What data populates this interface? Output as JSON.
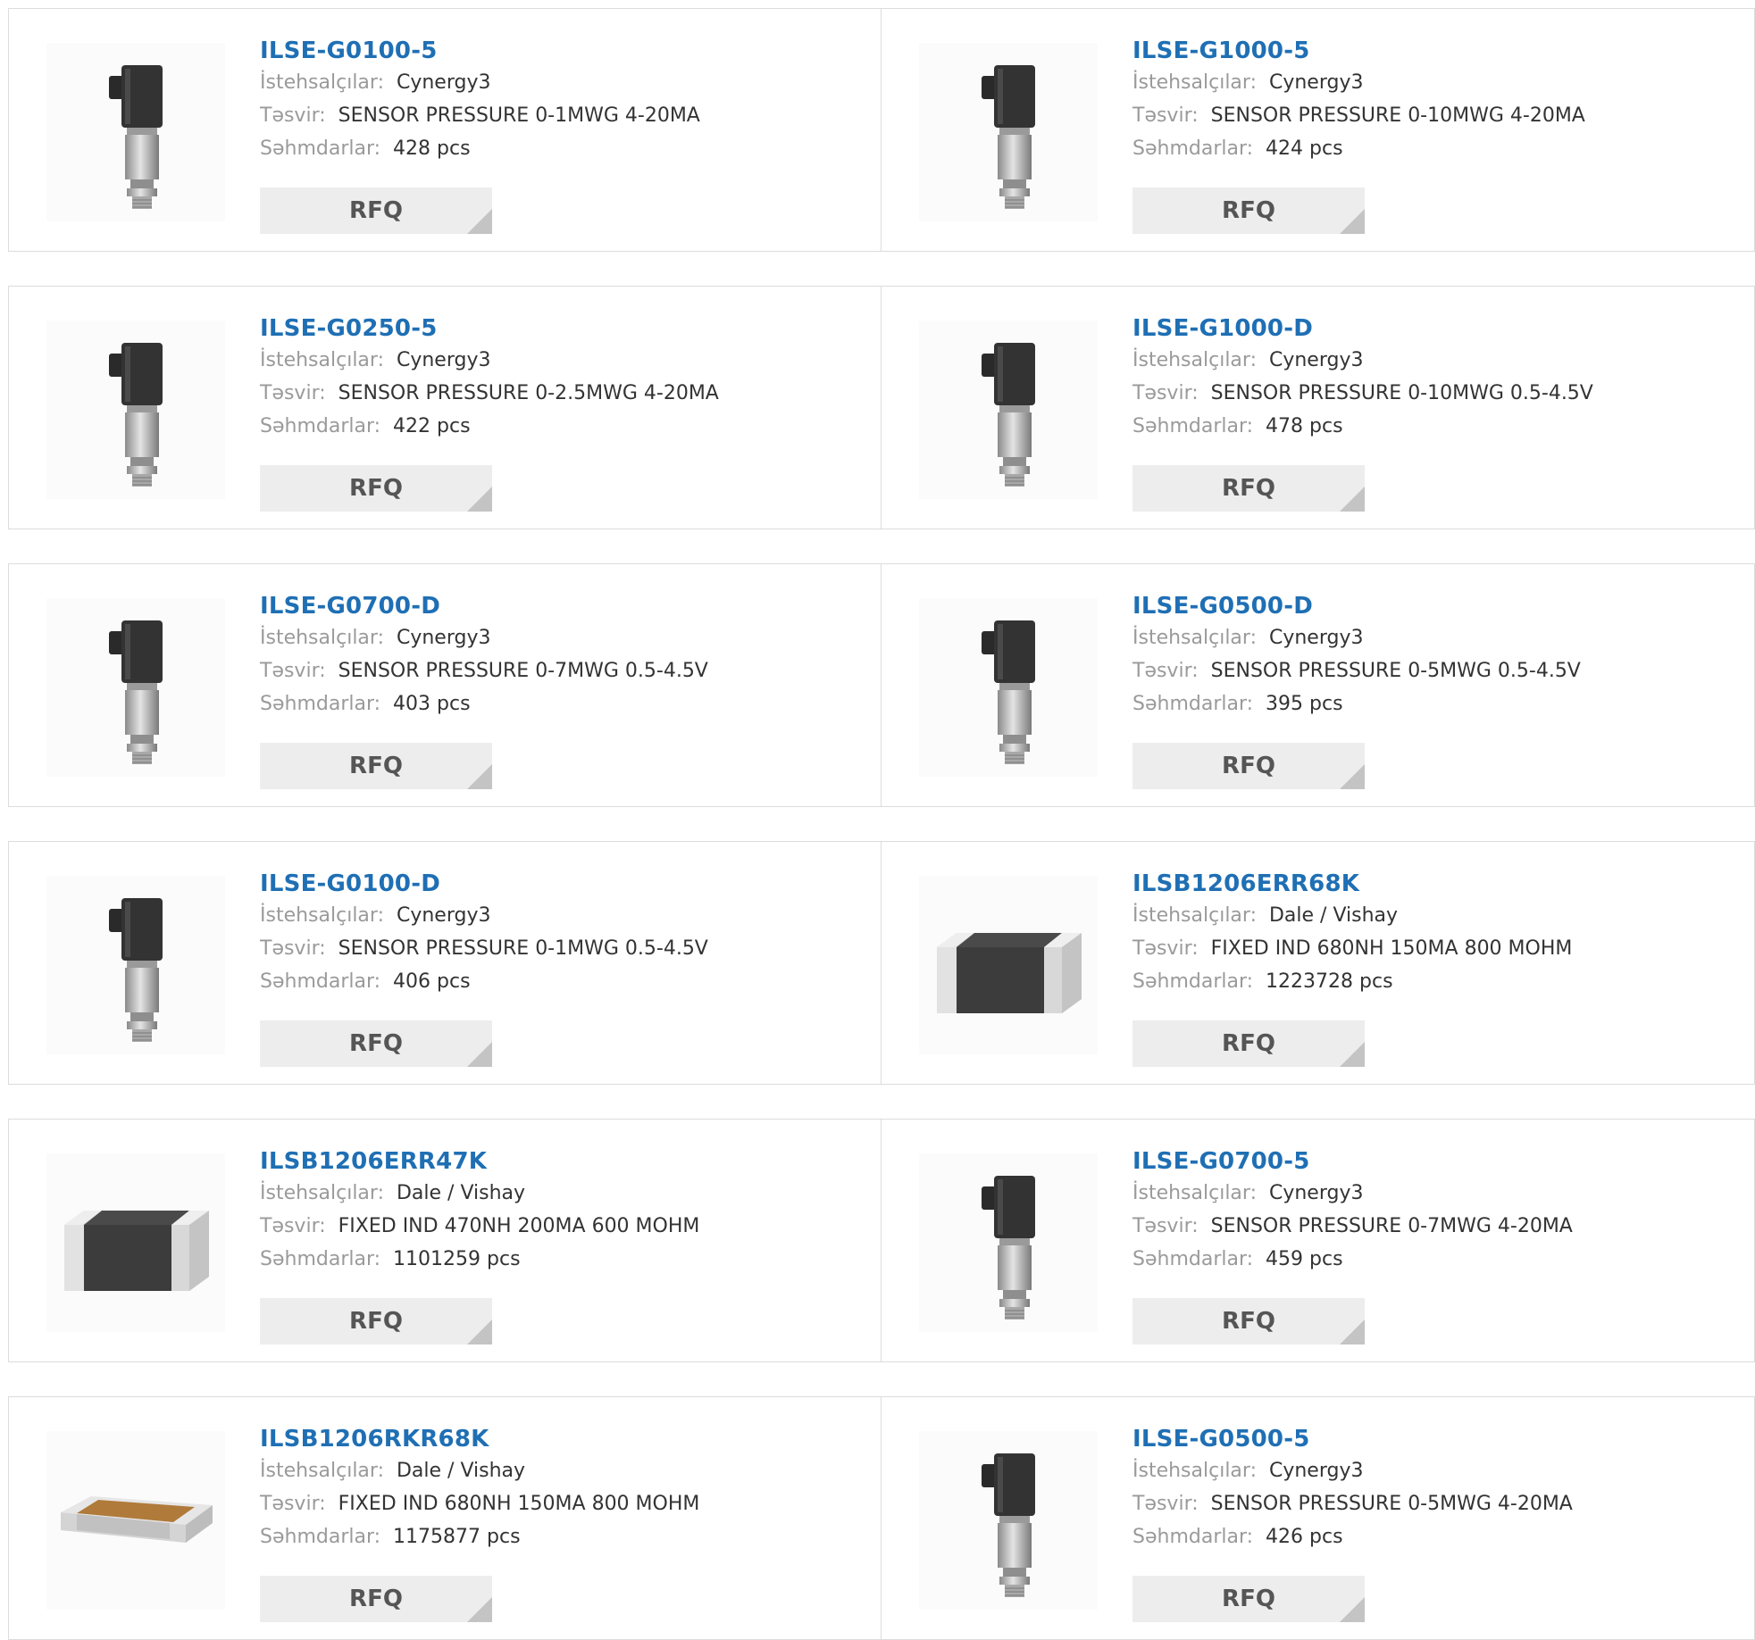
{
  "labels": {
    "manufacturer": "İstehsalçılar:",
    "description": "Təsvir:",
    "stock": "Səhmdarlar:",
    "rfq": "RFQ"
  },
  "products": [
    {
      "part": "ILSE-G0100-5",
      "manufacturer": "Cynergy3",
      "description": "SENSOR PRESSURE 0-1MWG 4-20MA",
      "stock": "428 pcs",
      "image": "pressure-sensor-icon"
    },
    {
      "part": "ILSE-G1000-5",
      "manufacturer": "Cynergy3",
      "description": "SENSOR PRESSURE 0-10MWG 4-20MA",
      "stock": "424 pcs",
      "image": "pressure-sensor-icon"
    },
    {
      "part": "ILSE-G0250-5",
      "manufacturer": "Cynergy3",
      "description": "SENSOR PRESSURE 0-2.5MWG 4-20MA",
      "stock": "422 pcs",
      "image": "pressure-sensor-icon"
    },
    {
      "part": "ILSE-G1000-D",
      "manufacturer": "Cynergy3",
      "description": "SENSOR PRESSURE 0-10MWG 0.5-4.5V",
      "stock": "478 pcs",
      "image": "pressure-sensor-icon"
    },
    {
      "part": "ILSE-G0700-D",
      "manufacturer": "Cynergy3",
      "description": "SENSOR PRESSURE 0-7MWG 0.5-4.5V",
      "stock": "403 pcs",
      "image": "pressure-sensor-icon"
    },
    {
      "part": "ILSE-G0500-D",
      "manufacturer": "Cynergy3",
      "description": "SENSOR PRESSURE 0-5MWG 0.5-4.5V",
      "stock": "395 pcs",
      "image": "pressure-sensor-icon"
    },
    {
      "part": "ILSE-G0100-D",
      "manufacturer": "Cynergy3",
      "description": "SENSOR PRESSURE 0-1MWG 0.5-4.5V",
      "stock": "406 pcs",
      "image": "pressure-sensor-icon"
    },
    {
      "part": "ILSB1206ERR68K",
      "manufacturer": "Dale / Vishay",
      "description": "FIXED IND 680NH 150MA 800 MOHM",
      "stock": "1223728 pcs",
      "image": "chip-inductor-dark-icon"
    },
    {
      "part": "ILSB1206ERR47K",
      "manufacturer": "Dale / Vishay",
      "description": "FIXED IND 470NH 200MA 600 MOHM",
      "stock": "1101259 pcs",
      "image": "chip-inductor-dark-icon"
    },
    {
      "part": "ILSE-G0700-5",
      "manufacturer": "Cynergy3",
      "description": "SENSOR PRESSURE 0-7MWG 4-20MA",
      "stock": "459 pcs",
      "image": "pressure-sensor-icon"
    },
    {
      "part": "ILSB1206RKR68K",
      "manufacturer": "Dale / Vishay",
      "description": "FIXED IND 680NH 150MA 800 MOHM",
      "stock": "1175877 pcs",
      "image": "chip-inductor-flat-icon"
    },
    {
      "part": "ILSE-G0500-5",
      "manufacturer": "Cynergy3",
      "description": "SENSOR PRESSURE 0-5MWG 4-20MA",
      "stock": "426 pcs",
      "image": "pressure-sensor-icon"
    }
  ]
}
